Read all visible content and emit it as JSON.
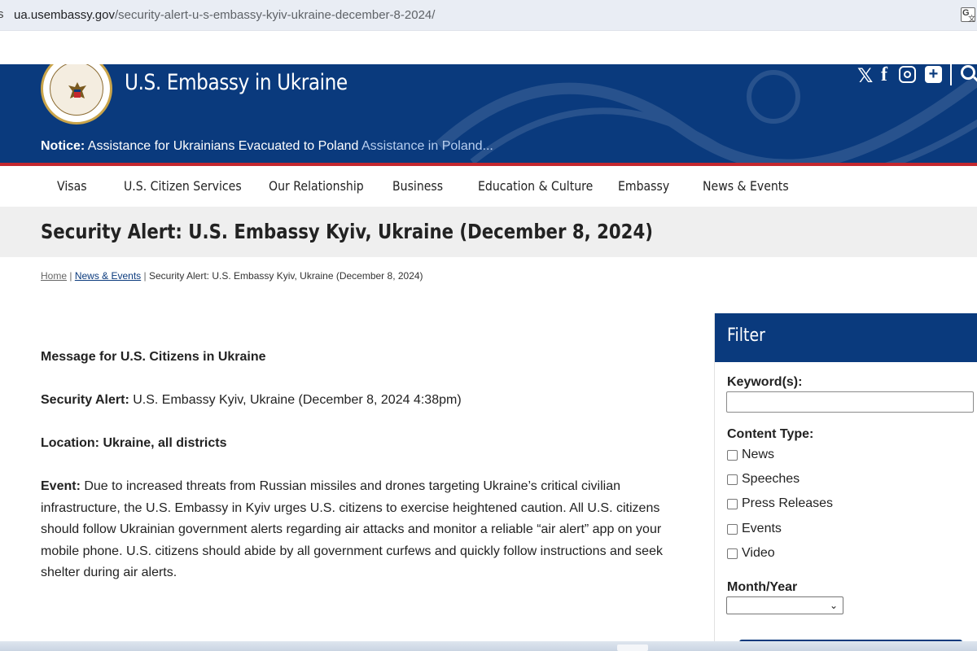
{
  "browser": {
    "lead_char": "s",
    "url_host": "ua.usembassy.gov",
    "url_path": "/security-alert-u-s-embassy-kyiv-ukraine-december-8-2024/",
    "translate_icon": "translate-icon"
  },
  "header": {
    "site_title": "U.S. Embassy in Ukraine",
    "seal_icon": "great-seal-icon",
    "notice_label": "Notice:",
    "notice_text": "Assistance for Ukrainians Evacuated to Poland",
    "notice_link": "Assistance in Poland...",
    "social": [
      "x-icon",
      "facebook-icon",
      "instagram-icon",
      "plus-icon",
      "search-icon"
    ],
    "colors": {
      "brand_blue": "#0a3a7d",
      "accent_red": "#c4282f"
    }
  },
  "nav": {
    "items": [
      "Visas",
      "U.S. Citizen Services",
      "Our Relationship",
      "Business",
      "Education & Culture",
      "Embassy",
      "News & Events"
    ]
  },
  "page": {
    "title": "Security Alert: U.S. Embassy Kyiv, Ukraine (December 8, 2024)"
  },
  "breadcrumb": {
    "home": "Home",
    "sep": " | ",
    "news": "News & Events",
    "current": "Security Alert: U.S. Embassy Kyiv, Ukraine (December 8, 2024)"
  },
  "content": {
    "heading": "Message for U.S. Citizens in Ukraine",
    "alert_label": "Security Alert:",
    "alert_text": " U.S. Embassy Kyiv, Ukraine (December 8, 2024 4:38pm)",
    "location": "Location: Ukraine, all districts",
    "event_label": "Event:",
    "event_text": " Due to increased threats from Russian missiles and drones targeting Ukraine’s critical civilian infrastructure, the U.S. Embassy in Kyiv urges U.S. citizens to exercise heightened caution.  All U.S. citizens should follow Ukrainian government alerts regarding air attacks and monitor a reliable “air alert” app on your mobile phone.  U.S. citizens should abide by all government curfews and quickly follow instructions and seek shelter during air alerts."
  },
  "filter": {
    "title": "Filter",
    "keyword_label": "Keyword(s):",
    "keyword_value": "",
    "content_type_label": "Content Type:",
    "content_types": [
      {
        "label": "News",
        "checked": false
      },
      {
        "label": "Speeches",
        "checked": false
      },
      {
        "label": "Press Releases",
        "checked": false
      },
      {
        "label": "Events",
        "checked": false
      },
      {
        "label": "Video",
        "checked": false
      }
    ],
    "month_year_label": "Month/Year",
    "month_year_value": ""
  }
}
